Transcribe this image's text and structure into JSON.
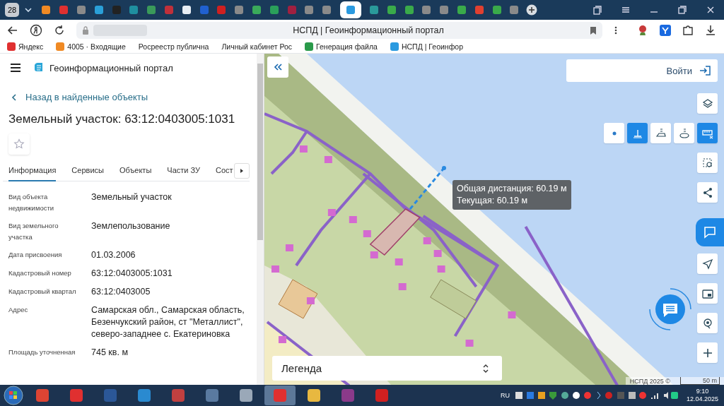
{
  "browser": {
    "tab_count": "28",
    "tabs": [
      {
        "color": "#f08a24",
        "selected": false
      },
      {
        "color": "#e03030",
        "selected": false
      },
      {
        "color": "#8a8a8a",
        "selected": false
      },
      {
        "color": "#2aa0d8",
        "selected": false
      },
      {
        "color": "#222222",
        "selected": false
      },
      {
        "color": "#1f8f9f",
        "selected": false
      },
      {
        "color": "#3a9a5a",
        "selected": false
      },
      {
        "color": "#c0303a",
        "selected": false
      },
      {
        "color": "#e8eef4",
        "selected": false
      },
      {
        "color": "#2060d0",
        "selected": false
      },
      {
        "color": "#d02020",
        "selected": false
      },
      {
        "color": "#8a8a8a",
        "selected": false
      },
      {
        "color": "#3aaa5a",
        "selected": false
      },
      {
        "color": "#2aa05a",
        "selected": false
      },
      {
        "color": "#a02040",
        "selected": false
      },
      {
        "color": "#8a8a8a",
        "selected": false
      },
      {
        "color": "#8a8a8a",
        "selected": false
      },
      {
        "color": "#2a9ae0",
        "selected": true
      },
      {
        "color": "#2a9a9a",
        "selected": false
      },
      {
        "color": "#3aaa4a",
        "selected": false
      },
      {
        "color": "#3aaa4a",
        "selected": false
      },
      {
        "color": "#8a8a8a",
        "selected": false
      },
      {
        "color": "#8a8a8a",
        "selected": false
      },
      {
        "color": "#3aaa4a",
        "selected": false
      },
      {
        "color": "#e04030",
        "selected": false
      },
      {
        "color": "#3aaa4a",
        "selected": false
      },
      {
        "color": "#8a8a8a",
        "selected": false
      }
    ],
    "page_title": "НСПД | Геоинформационный портал",
    "bookmarks": [
      {
        "label": "Яндекс",
        "color": "#e03030"
      },
      {
        "label": "4005 · Входящие",
        "color": "#f08a24"
      },
      {
        "label": "Росреестр публична"
      },
      {
        "label": "Личный кабинет Рос"
      },
      {
        "label": "Генерация файла",
        "color": "#2a9a4a"
      },
      {
        "label": "НСПД | Геоинфор",
        "color": "#2a9ae0"
      }
    ]
  },
  "sidebar": {
    "portal_title": "Геоинформационный портал",
    "back_link": "Назад в найденные объекты",
    "title": "Земельный участок: 63:12:0403005:1031",
    "tabs": [
      {
        "label": "Информация",
        "selected": true
      },
      {
        "label": "Сервисы",
        "selected": false
      },
      {
        "label": "Объекты",
        "selected": false
      },
      {
        "label": "Части ЗУ",
        "selected": false
      },
      {
        "label": "Сост",
        "selected": false
      }
    ],
    "fields": [
      {
        "label": "Вид объекта недвижимости",
        "value": "Земельный участок"
      },
      {
        "label": "Вид земельного участка",
        "value": "Землепользование"
      },
      {
        "label": "Дата присвоения",
        "value": "01.03.2006"
      },
      {
        "label": "Кадастровый номер",
        "value": "63:12:0403005:1031"
      },
      {
        "label": "Кадастровый квартал",
        "value": "63:12:0403005"
      },
      {
        "label": "Адрес",
        "value": "Самарская обл., Самарская область, Безенчукский район, ст \"Металлист\", северо-западнее с. Екатериновка"
      },
      {
        "label": "Площадь уточненная",
        "value": "745 кв. м"
      }
    ]
  },
  "map": {
    "login_button": "Войти",
    "measure_tools": [
      {
        "kind": "point",
        "selected": false
      },
      {
        "kind": "line",
        "selected": true
      },
      {
        "kind": "polygon",
        "selected": false
      },
      {
        "kind": "circle",
        "selected": false
      }
    ],
    "side_tools": [
      {
        "kind": "layers",
        "selected": false
      },
      {
        "kind": "ruler",
        "selected": true
      },
      {
        "kind": "select",
        "selected": false
      },
      {
        "kind": "share",
        "selected": false
      },
      {
        "kind": "navigate",
        "selected": false
      },
      {
        "kind": "minimap",
        "selected": false
      },
      {
        "kind": "location",
        "selected": false
      },
      {
        "kind": "zoom-in",
        "selected": false
      }
    ],
    "tooltip": [
      "Общая дистанция: 60.19 м",
      "Текущая: 60.19 м"
    ],
    "legend": "Легенда",
    "attribution": "НСПД 2025 ©",
    "scale": "50 m"
  },
  "taskbar": {
    "apps": [
      {
        "color": "#dd4433",
        "selected": false
      },
      {
        "color": "#e03030",
        "selected": false
      },
      {
        "color": "#2b5797",
        "selected": false
      },
      {
        "color": "#2a8ad0",
        "selected": false
      },
      {
        "color": "#c04040",
        "selected": false
      },
      {
        "color": "#5a7aa0",
        "selected": false
      },
      {
        "color": "#9aa8b8",
        "selected": false
      },
      {
        "color": "#e03030",
        "selected": true
      },
      {
        "color": "#e8b840",
        "selected": false
      },
      {
        "color": "#8a3a8a",
        "selected": false
      },
      {
        "color": "#d02020",
        "selected": false
      }
    ],
    "language": "RU",
    "time": "9:10",
    "date": "12.04.2025"
  }
}
